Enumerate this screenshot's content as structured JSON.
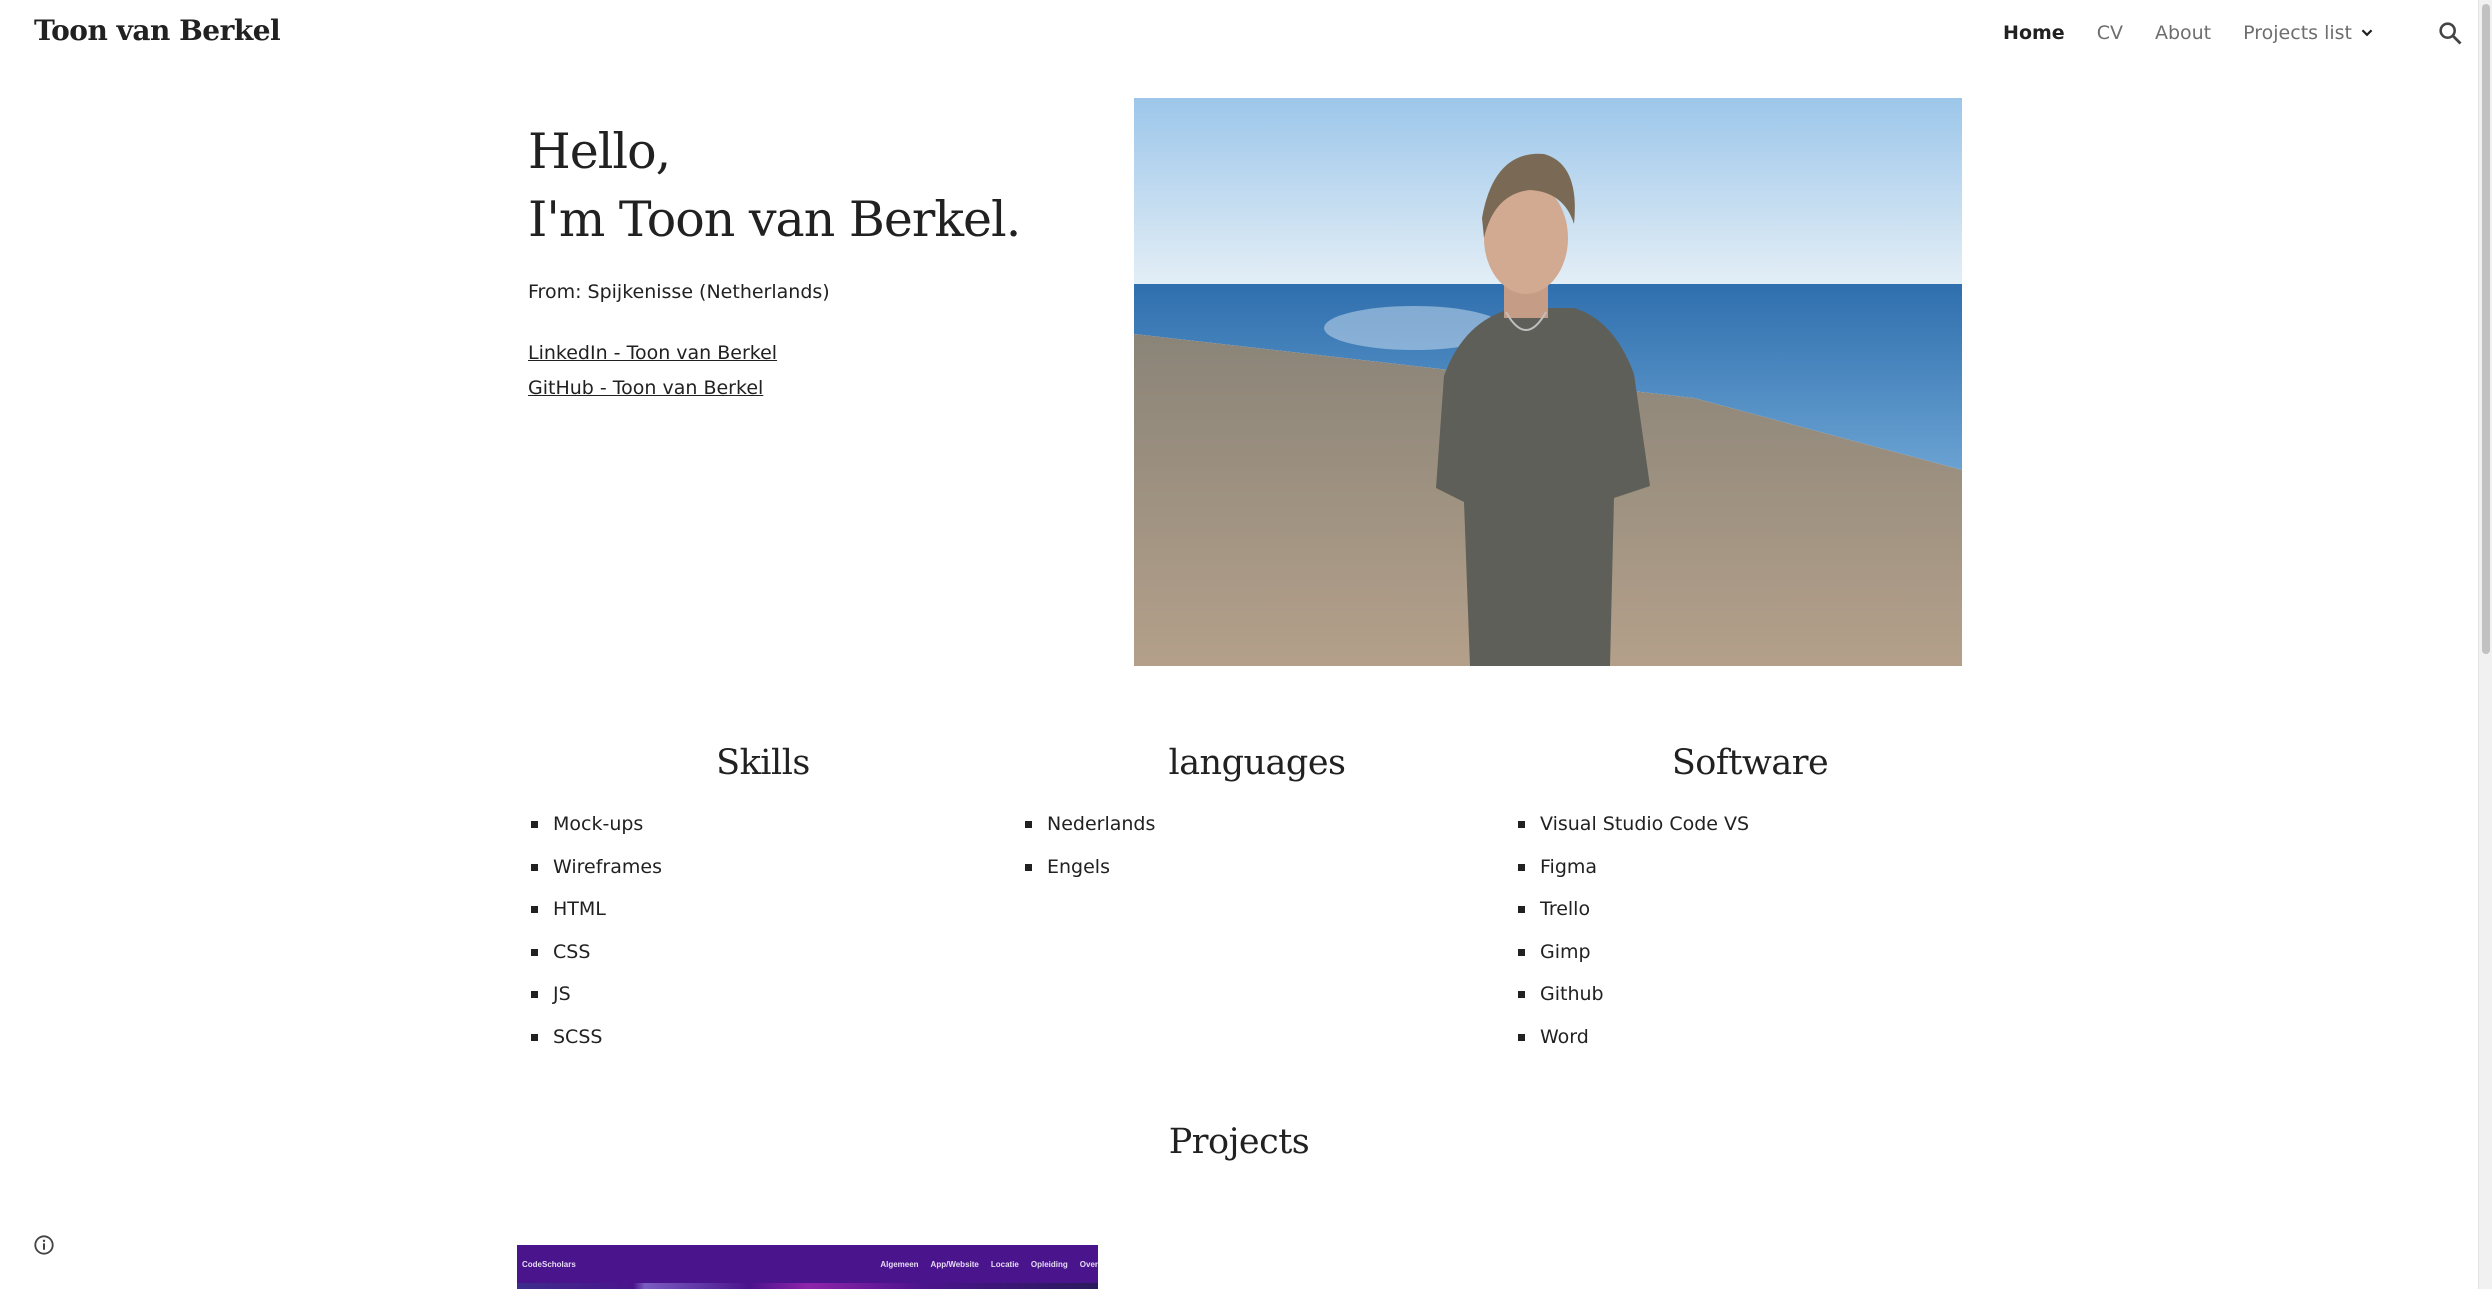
{
  "header": {
    "site_title": "Toon van Berkel",
    "nav": [
      {
        "label": "Home",
        "active": true
      },
      {
        "label": "CV",
        "active": false
      },
      {
        "label": "About",
        "active": false
      },
      {
        "label": "Projects list",
        "active": false,
        "has_dropdown": true
      }
    ],
    "search_icon": "search-icon"
  },
  "hero": {
    "greeting_line1": "Hello,",
    "greeting_line2": "I'm Toon van Berkel.",
    "from": "From: Spijkenisse (Netherlands)",
    "links": [
      {
        "label": "LinkedIn - Toon van Berkel"
      },
      {
        "label": "GitHub - Toon van Berkel"
      }
    ],
    "photo_alt": "Photo of Toon van Berkel on a beach"
  },
  "sections": {
    "skills": {
      "title": "Skills",
      "items": [
        "Mock-ups",
        "Wireframes",
        "HTML",
        "CSS",
        "JS",
        "SCSS"
      ]
    },
    "languages": {
      "title": "languages",
      "items": [
        "Nederlands",
        "Engels"
      ]
    },
    "software": {
      "title": "Software",
      "items": [
        "Visual Studio Code VS",
        "Figma",
        "Trello",
        "Gimp",
        "Github",
        "Word"
      ]
    }
  },
  "projects": {
    "title": "Projects",
    "thumbnail": {
      "brand": "CodeScholars",
      "nav": [
        "Algemeen",
        "App/Website",
        "Locatie",
        "Opleiding",
        "Over"
      ],
      "accent_color": "#4a148c"
    }
  },
  "footer": {
    "info_icon": "info-icon"
  }
}
